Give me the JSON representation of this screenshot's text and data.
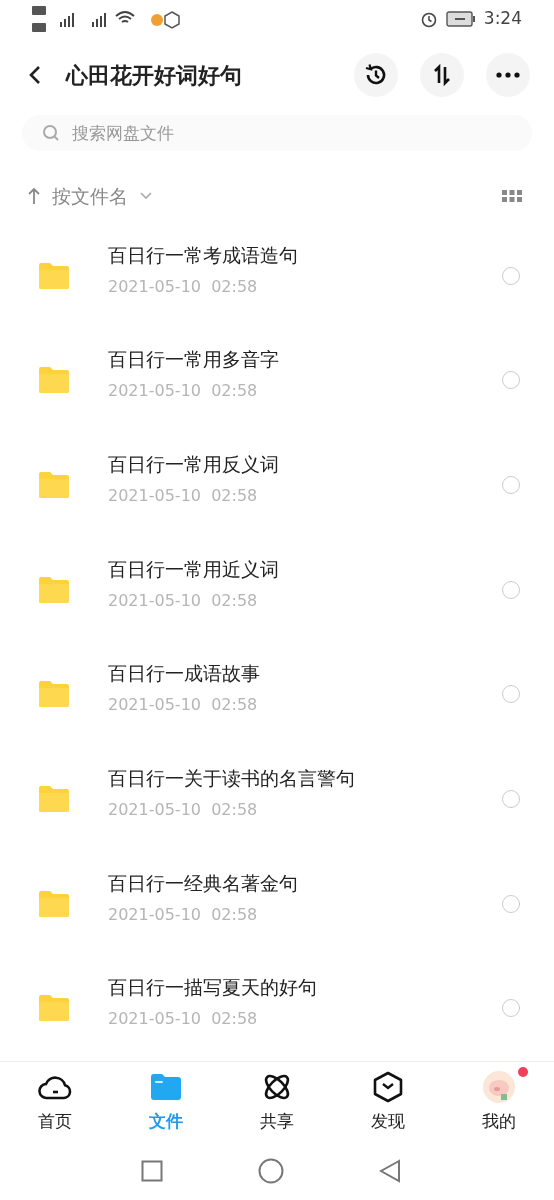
{
  "status_bar": {
    "time": "3:24"
  },
  "header": {
    "title": "心田花开好词好句"
  },
  "search": {
    "placeholder": "搜索网盘文件"
  },
  "sort": {
    "label": "按文件名"
  },
  "files": [
    {
      "name": "百日行一常考成语造句",
      "date": "2021-05-10  02:58",
      "selected": false
    },
    {
      "name": "百日行一常用多音字",
      "date": "2021-05-10  02:58",
      "selected": false
    },
    {
      "name": "百日行一常用反义词",
      "date": "2021-05-10  02:58",
      "selected": false
    },
    {
      "name": "百日行一常用近义词",
      "date": "2021-05-10  02:58",
      "selected": false
    },
    {
      "name": "百日行一成语故事",
      "date": "2021-05-10  02:58",
      "selected": false
    },
    {
      "name": "百日行一关于读书的名言警句",
      "date": "2021-05-10  02:58",
      "selected": false
    },
    {
      "name": "百日行一经典名著金句",
      "date": "2021-05-10  02:58",
      "selected": false
    },
    {
      "name": "百日行一描写夏天的好句",
      "date": "2021-05-10  02:58",
      "selected": false
    }
  ],
  "tabs": [
    {
      "kind": "home",
      "label": "首页",
      "selected": false
    },
    {
      "kind": "files",
      "label": "文件",
      "selected": true
    },
    {
      "kind": "share",
      "label": "共享",
      "selected": false
    },
    {
      "kind": "discover",
      "label": "发现",
      "selected": false
    },
    {
      "kind": "me",
      "label": "我的",
      "selected": false,
      "badge": true
    }
  ]
}
